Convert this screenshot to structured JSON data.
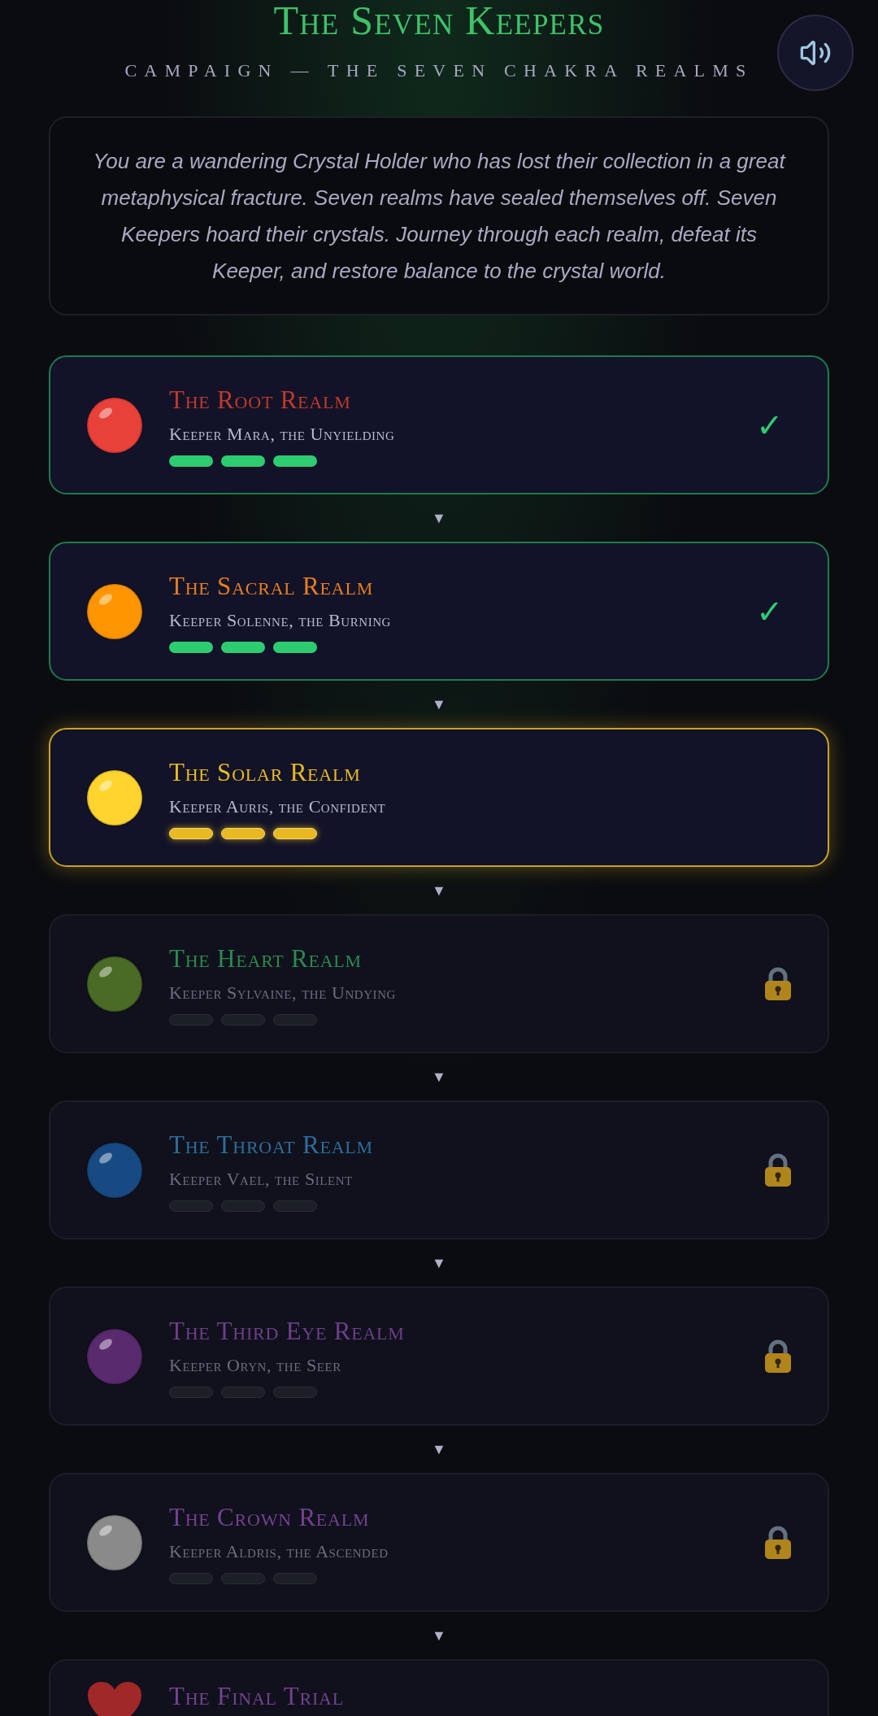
{
  "header": {
    "title": "The Seven Keepers",
    "subtitle": "CAMPAIGN — THE SEVEN CHAKRA REALMS"
  },
  "intro": "You are a wandering Crystal Holder who has lost their collection in a great metaphysical fracture. Seven realms have sealed themselves off. Seven Keepers hoard their crystals. Journey through each realm, defeat its Keeper, and restore balance to the crystal world.",
  "realms": [
    {
      "title": "The Root Realm",
      "keeper": "Keeper Mara, the Unyielding",
      "kind": "cleared",
      "color": "#c0392b",
      "orb": {
        "color": "#e8413a"
      },
      "mark": "✓"
    },
    {
      "title": "The Sacral Realm",
      "keeper": "Keeper Solenne, the Burning",
      "kind": "cleared",
      "color": "#e67e22",
      "orb": {
        "color": "#ff9500"
      },
      "mark": "✓"
    },
    {
      "title": "The Solar Realm",
      "keeper": "Keeper Auris, the Confident",
      "kind": "current",
      "color": "#e8b923",
      "orb": {
        "color": "#ffd42e"
      }
    },
    {
      "title": "The Heart Realm",
      "keeper": "Keeper Sylvaine, the Undying",
      "kind": "locked",
      "color": "#2a8a50",
      "orb": {
        "color": "#4a6b26"
      }
    },
    {
      "title": "The Throat Realm",
      "keeper": "Keeper Vael, the Silent",
      "kind": "locked",
      "color": "#2d6d9c",
      "orb": {
        "color": "#174a82"
      }
    },
    {
      "title": "The Third Eye Realm",
      "keeper": "Keeper Oryn, the Seer",
      "kind": "locked",
      "color": "#6e3f8a",
      "orb": {
        "color": "#5a2a6e"
      }
    },
    {
      "title": "The Crown Realm",
      "keeper": "Keeper Aldris, the Ascended",
      "kind": "locked",
      "color": "#74428f",
      "orb": {
        "color": "#8a8a8a"
      }
    },
    {
      "title": "The Final Trial",
      "kind": "final",
      "color": "#74428f",
      "orb": {
        "color": "#a02828"
      }
    }
  ],
  "connector": "▼"
}
